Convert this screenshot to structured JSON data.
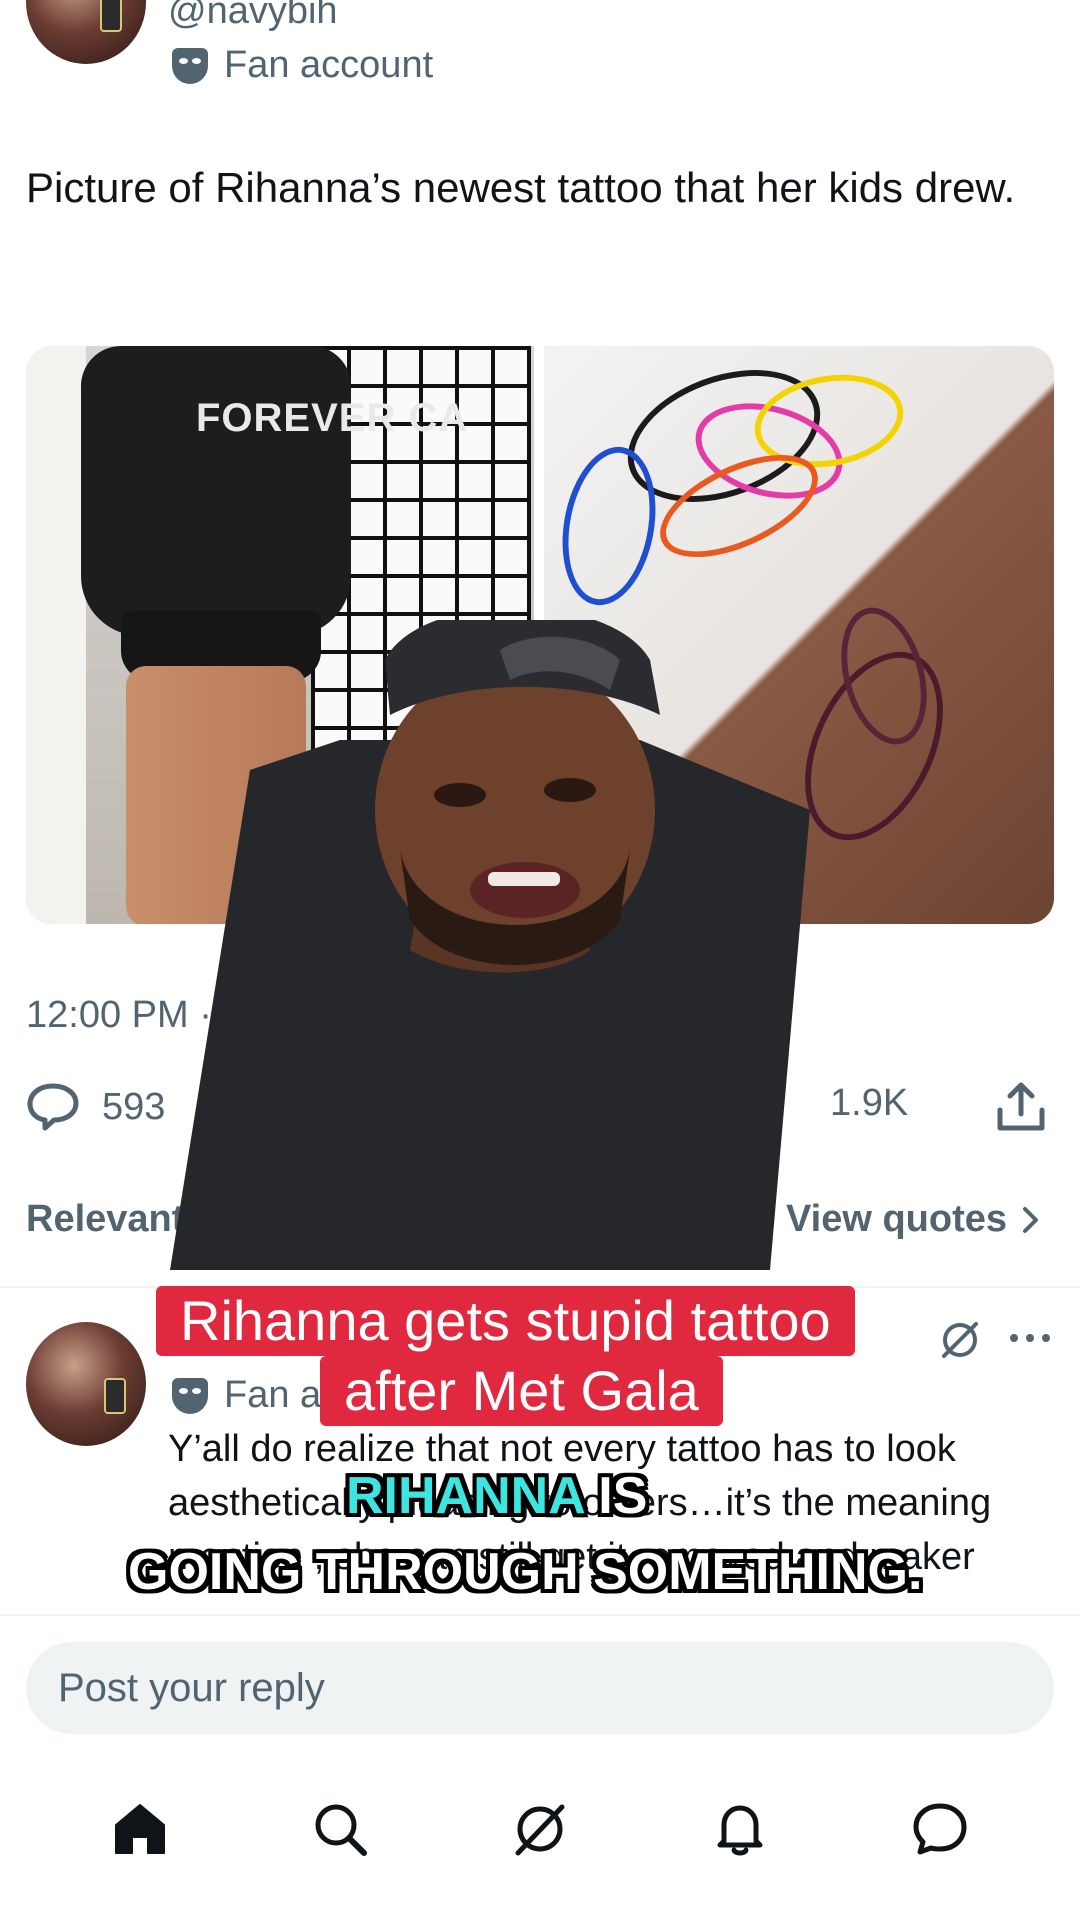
{
  "tweet": {
    "handle": "@navybih",
    "badge_label": "Fan account",
    "text": "Picture of Rihanna’s newest tattoo that her kids drew.",
    "hoodie_print": "FOREVER CA",
    "time": "12:00 PM · 5",
    "reply_count": "593",
    "like_count": "1.9K"
  },
  "replies_header": {
    "sort_label": "Relevant",
    "view_quotes_label": "View quotes"
  },
  "reply": {
    "badge_label": "Fan a",
    "text_line1": "Y’all do realize that not every tattoo has to look",
    "text_line2": "aesthetically pleasing to others…it’s the meaning",
    "text_line3": "mention , she can still get it removed and maker"
  },
  "composer": {
    "placeholder": "Post your reply"
  },
  "overlay": {
    "headline_line1": "Rihanna gets stupid tattoo",
    "headline_line2": "after Met Gala",
    "subtitle_highlight": "RIHANNA",
    "subtitle_rest1": " IS",
    "subtitle_line2": "GOING THROUGH SOMETHING."
  },
  "nav": [
    "home-icon",
    "search-icon",
    "grok-icon",
    "notifications-icon",
    "messages-icon"
  ],
  "colors": {
    "caption_red": "#e0283e",
    "subtitle_highlight": "#3ee4e0",
    "secondary_text": "#536471"
  }
}
